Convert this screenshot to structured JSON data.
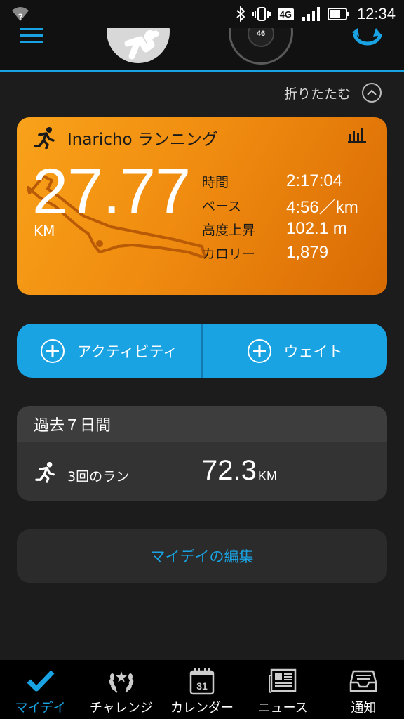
{
  "status_bar": {
    "time": "12:34",
    "network": "4G",
    "wifi_badge": "?"
  },
  "header": {
    "watch_display": "46",
    "icons": [
      "menu-icon",
      "avatar-runner",
      "watch-icon",
      "sync-icon"
    ]
  },
  "collapse": {
    "label": "折りたたむ"
  },
  "activity": {
    "title": "Inaricho ランニング",
    "distance": "27.77",
    "distance_unit": "KM",
    "stats": [
      {
        "label": "時間",
        "value": "2:17:04"
      },
      {
        "label": "ペース",
        "value": "4:56／km"
      },
      {
        "label": "高度上昇",
        "value": "102.1 m"
      },
      {
        "label": "カロリー",
        "value": "1,879"
      }
    ],
    "color": "#f39a17"
  },
  "add_buttons": {
    "activity_label": "アクティビティ",
    "weight_label": "ウェイト",
    "color": "#1aa3e3"
  },
  "past_week": {
    "title": "過去７日間",
    "run_label": "3回のラン",
    "value": "72.3",
    "unit": "KM"
  },
  "edit": {
    "label": "マイデイの編集"
  },
  "bottom_nav": {
    "items": [
      {
        "label": "マイデイ",
        "icon": "check-icon",
        "active": true
      },
      {
        "label": "チャレンジ",
        "icon": "laurel-icon",
        "active": false
      },
      {
        "label": "カレンダー",
        "icon": "calendar-icon",
        "active": false
      },
      {
        "label": "ニュース",
        "icon": "news-icon",
        "active": false
      },
      {
        "label": "通知",
        "icon": "inbox-icon",
        "active": false
      }
    ],
    "calendar_day": "31"
  }
}
